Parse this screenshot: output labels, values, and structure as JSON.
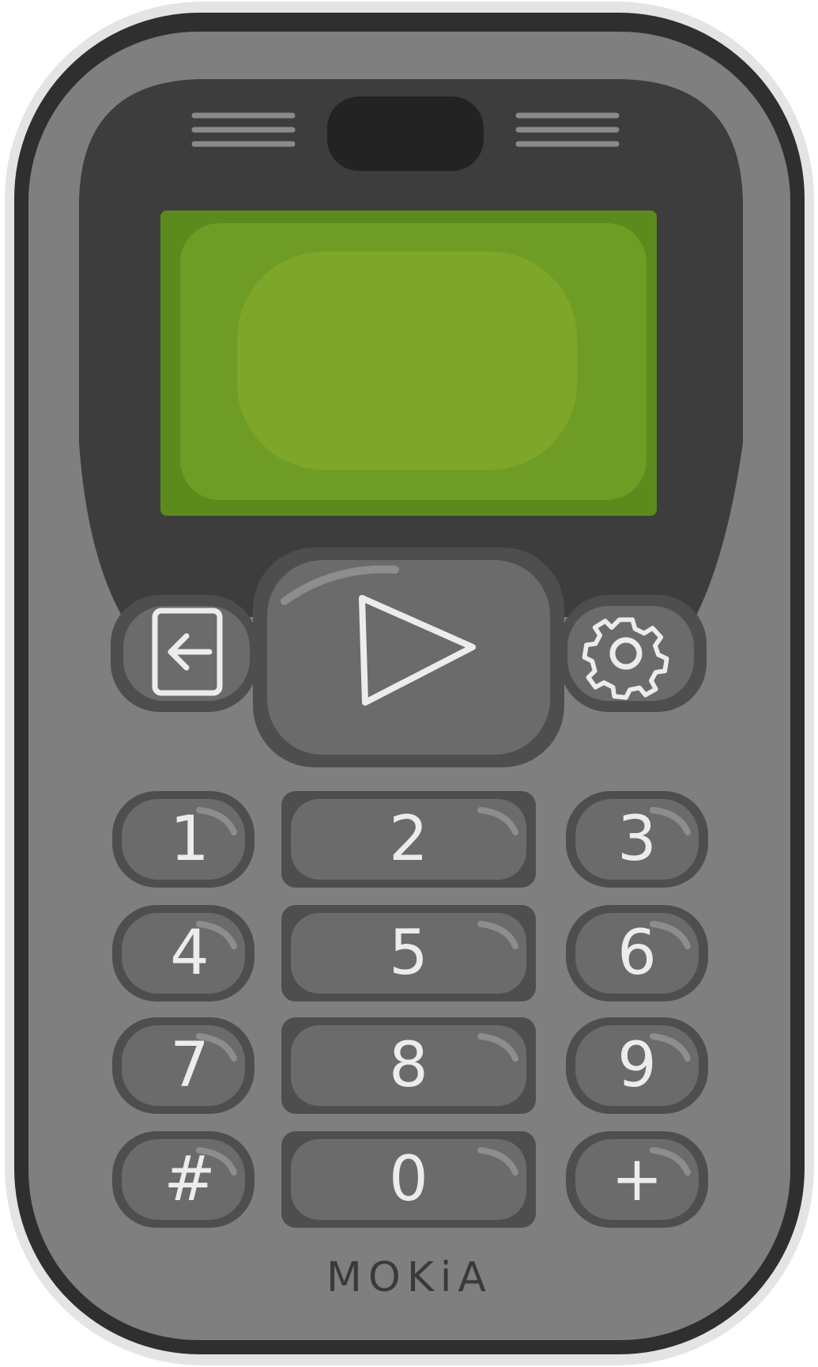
{
  "device": {
    "brand": "MOKiA",
    "colors": {
      "body": "#7e7f7e",
      "outline": "#2f2f2f",
      "halo": "#e4e4e4",
      "bezel": "#3d3d3d",
      "screen_outer": "#5c8a1c",
      "screen_mid": "#6f9c24",
      "screen_center": "#7ea72a",
      "key_dark": "#4e4e4e",
      "key_face": "#6b6b6b",
      "key_symbol": "#ececec"
    },
    "screen": {
      "content": ""
    },
    "navigation": {
      "left_key_icon": "exit-arrow-icon",
      "center_key_icon": "play-icon",
      "right_key_icon": "gear-icon"
    },
    "keypad": {
      "keys": [
        "1",
        "2",
        "3",
        "4",
        "5",
        "6",
        "7",
        "8",
        "9",
        "#",
        "0",
        "+"
      ]
    }
  }
}
